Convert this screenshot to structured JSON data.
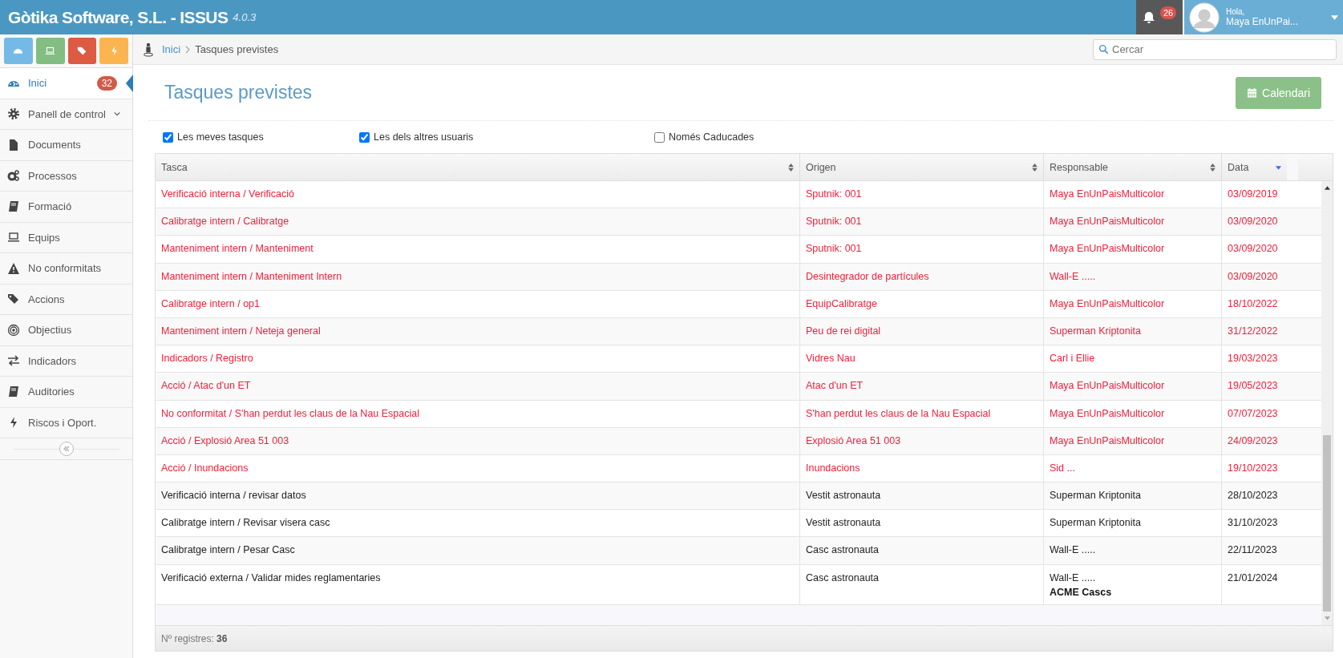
{
  "app": {
    "title": "Gòtika Software, S.L. - ISSUS",
    "version": "4.0.3"
  },
  "notifications": {
    "count": "26"
  },
  "user": {
    "greeting": "Hola,",
    "name": "Maya EnUnPai..."
  },
  "quick_buttons": [
    {
      "kind": "dashboard",
      "color": "#75b9e6"
    },
    {
      "kind": "laptop",
      "color": "#82bd82"
    },
    {
      "kind": "tags",
      "color": "#dd5a43"
    },
    {
      "kind": "bolt",
      "color": "#fbb550"
    }
  ],
  "sidebar": {
    "items": [
      {
        "label": "Inici",
        "kind": "dashboard",
        "selected": true,
        "badge": "32"
      },
      {
        "label": "Panell de control",
        "kind": "gear",
        "selected": false,
        "expandable": true
      },
      {
        "label": "Documents",
        "kind": "file",
        "selected": false
      },
      {
        "label": "Processos",
        "kind": "gears",
        "selected": false
      },
      {
        "label": "Formació",
        "kind": "book",
        "selected": false
      },
      {
        "label": "Equips",
        "kind": "laptop",
        "selected": false
      },
      {
        "label": "No conformitats",
        "kind": "warning",
        "selected": false
      },
      {
        "label": "Accions",
        "kind": "tags",
        "selected": false
      },
      {
        "label": "Objectius",
        "kind": "target",
        "selected": false
      },
      {
        "label": "Indicadors",
        "kind": "exchange",
        "selected": false
      },
      {
        "label": "Auditories",
        "kind": "book",
        "selected": false
      },
      {
        "label": "Riscos i Oport.",
        "kind": "bolt",
        "selected": false
      }
    ]
  },
  "breadcrumb": [
    "Inici",
    "Tasques previstes"
  ],
  "search": {
    "placeholder": "Cercar"
  },
  "page_title": "Tasques previstes",
  "calendar_button": "Calendari",
  "filters": [
    {
      "label": "Les meves tasques",
      "checked": true
    },
    {
      "label": "Les dels altres usuaris",
      "checked": true
    },
    {
      "label": "Només Caducades",
      "checked": false
    }
  ],
  "table": {
    "columns": [
      {
        "label": "Tasca",
        "sorted": false
      },
      {
        "label": "Origen",
        "sorted": false
      },
      {
        "label": "Responsable",
        "sorted": false
      },
      {
        "label": "Data",
        "sorted": true
      }
    ],
    "rows": [
      {
        "task": "Verificació interna / Verificació",
        "origin": "Sputnik: 001",
        "responsible": "Maya EnUnPaisMulticolor",
        "date": "03/09/2019",
        "overdue": true
      },
      {
        "task": "Calibratge intern / Calibratge",
        "origin": "Sputnik: 001",
        "responsible": "Maya EnUnPaisMulticolor",
        "date": "03/09/2020",
        "overdue": true
      },
      {
        "task": "Manteniment intern / Manteniment",
        "origin": "Sputnik: 001",
        "responsible": "Maya EnUnPaisMulticolor",
        "date": "03/09/2020",
        "overdue": true
      },
      {
        "task": "Manteniment intern / Manteniment Intern",
        "origin": "Desintegrador de partícules",
        "responsible": "Wall-E .....",
        "date": "03/09/2020",
        "overdue": true
      },
      {
        "task": "Calibratge intern / op1",
        "origin": "EquipCalibratge",
        "responsible": "Maya EnUnPaisMulticolor",
        "date": "18/10/2022",
        "overdue": true
      },
      {
        "task": "Manteniment intern / Neteja general",
        "origin": "Peu de rei digital",
        "responsible": "Superman Kriptonita",
        "date": "31/12/2022",
        "overdue": true
      },
      {
        "task": "Indicadors / Registro",
        "origin": "Vidres Nau",
        "responsible": "Carl i Ellie",
        "date": "19/03/2023",
        "overdue": true
      },
      {
        "task": "Acció / Atac d'un ET",
        "origin": "Atac d'un ET",
        "responsible": "Maya EnUnPaisMulticolor",
        "date": "19/05/2023",
        "overdue": true
      },
      {
        "task": "No conformitat / S'han perdut les claus de la Nau Espacial",
        "origin": "S'han perdut les claus de la Nau Espacial",
        "responsible": "Maya EnUnPaisMulticolor",
        "date": "07/07/2023",
        "overdue": true
      },
      {
        "task": "Acció / Explosió Area 51 003",
        "origin": "Explosió Area 51 003",
        "responsible": "Maya EnUnPaisMulticolor",
        "date": "24/09/2023",
        "overdue": true
      },
      {
        "task": "Acció / Inundacions",
        "origin": "Inundacions",
        "responsible": "Sid ...",
        "date": "19/10/2023",
        "overdue": true
      },
      {
        "task": "Verificació interna / revisar datos",
        "origin": "Vestit astronauta",
        "responsible": "Superman Kriptonita",
        "date": "28/10/2023",
        "overdue": false
      },
      {
        "task": "Calibratge intern / Revisar visera casc",
        "origin": "Vestit astronauta",
        "responsible": "Superman Kriptonita",
        "date": "31/10/2023",
        "overdue": false
      },
      {
        "task": "Calibratge intern / Pesar Casc",
        "origin": "Casc astronauta",
        "responsible": "Wall-E .....",
        "date": "22/11/2023",
        "overdue": false
      },
      {
        "task": "Verificació externa / Validar mides reglamentaries",
        "origin": "Casc astronauta",
        "responsible": "Wall-E .....",
        "provider": "ACME Cascs",
        "date": "21/01/2024",
        "overdue": false
      }
    ],
    "footer_label": "Nº registres:",
    "footer_count": "36"
  }
}
